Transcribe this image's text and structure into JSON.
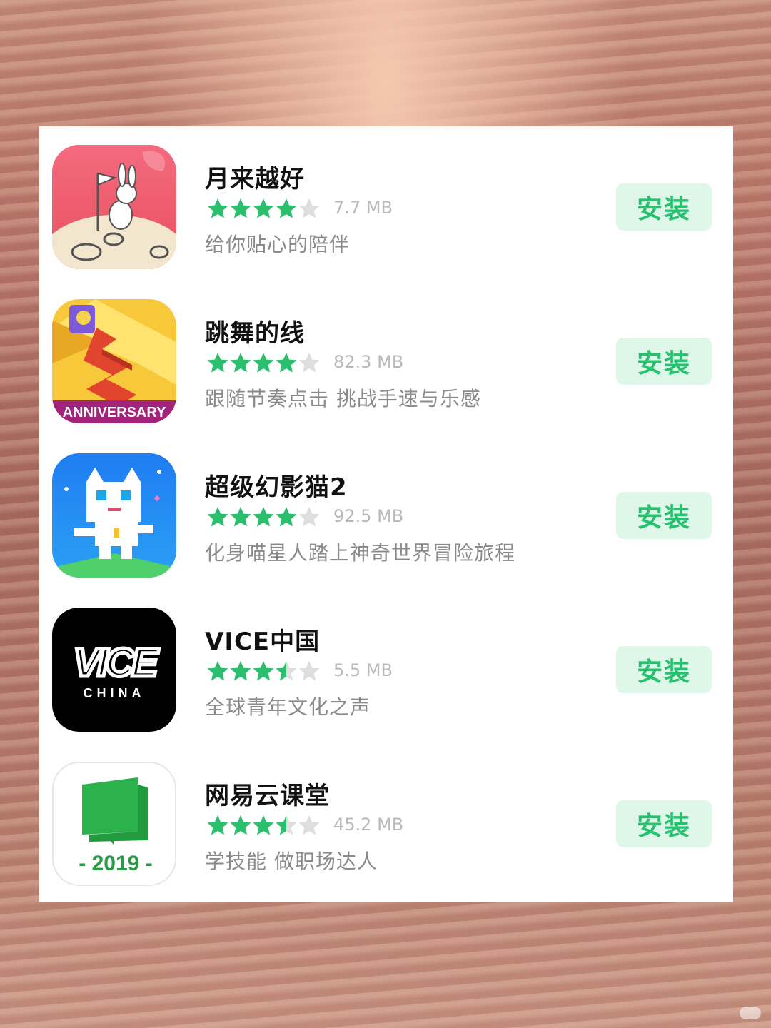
{
  "colors": {
    "star_filled": "#2bbf6d",
    "star_empty": "#dedede",
    "install_bg": "#dff7e8",
    "install_text": "#25c16f"
  },
  "apps": [
    {
      "name": "月来越好",
      "rating": 4,
      "size": "7.7 MB",
      "description": "给你贴心的陪伴",
      "install_label": "安装",
      "icon": "moon-rabbit-flag-icon"
    },
    {
      "name": "跳舞的线",
      "rating": 4,
      "size": "82.3 MB",
      "description": "跟随节奏点击 挑战手速与乐感",
      "install_label": "安装",
      "icon": "dancing-line-zigzag-icon",
      "icon_text": "ANNIVERSARY"
    },
    {
      "name": "超级幻影猫2",
      "rating": 4,
      "size": "92.5 MB",
      "description": "化身喵星人踏上神奇世界冒险旅程",
      "install_label": "安装",
      "icon": "white-pixel-cat-icon"
    },
    {
      "name": "VICE中国",
      "rating": 3.5,
      "size": "5.5 MB",
      "description": "全球青年文化之声",
      "install_label": "安装",
      "icon": "vice-china-logo-icon",
      "icon_text": "VICE",
      "icon_subtext": "CHINA"
    },
    {
      "name": "网易云课堂",
      "rating": 3.5,
      "size": "45.2 MB",
      "description": "学技能 做职场达人",
      "install_label": "安装",
      "icon": "green-book-chat-icon",
      "icon_text": "- 2019 -"
    }
  ]
}
